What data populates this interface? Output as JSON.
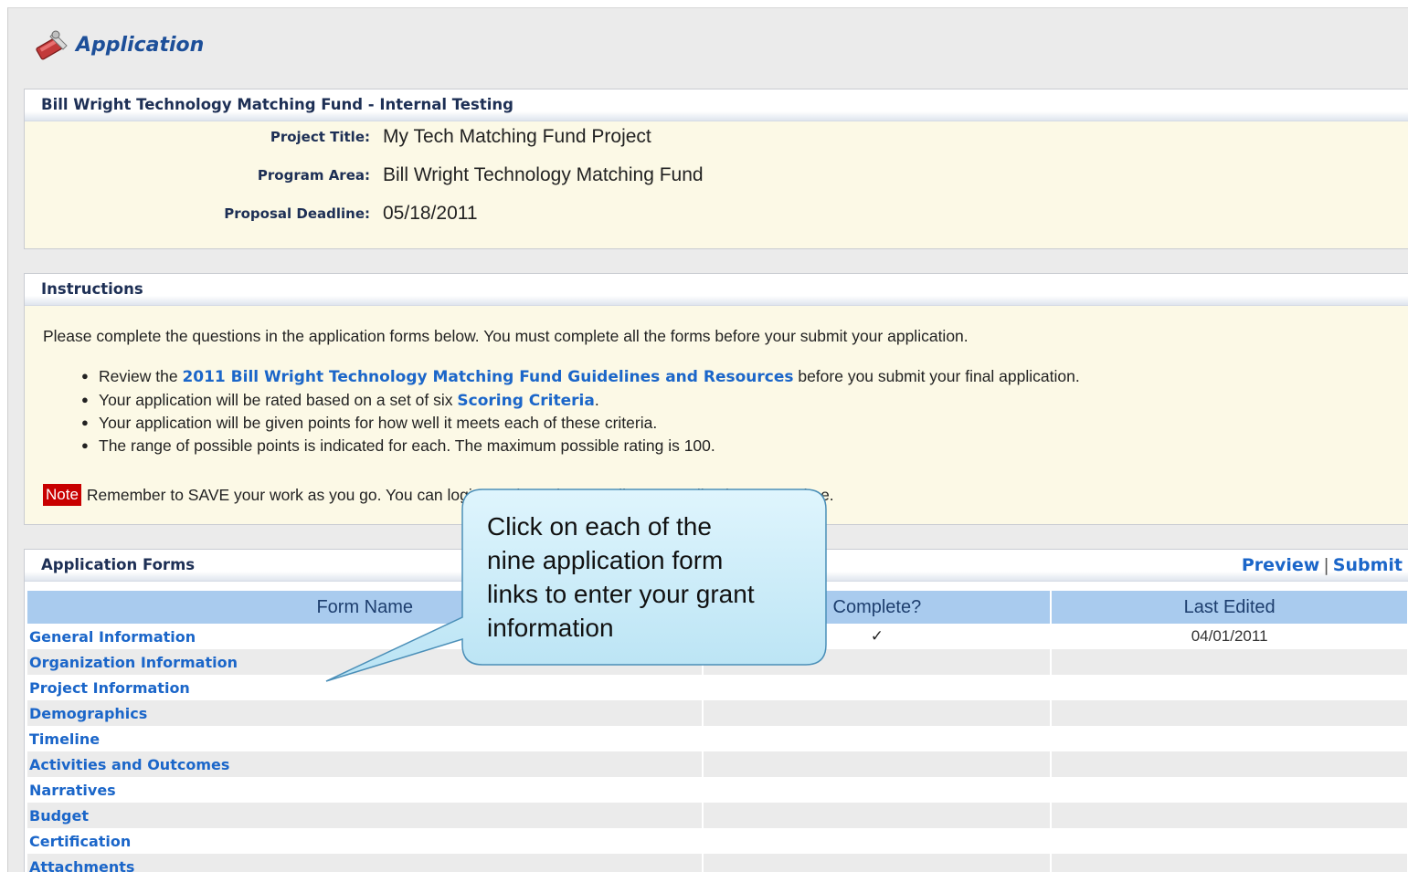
{
  "app": {
    "title": "Application"
  },
  "project": {
    "heading": "Bill Wright Technology Matching Fund - Internal Testing",
    "fields": [
      {
        "label": "Project Title:",
        "value": "My Tech Matching Fund Project"
      },
      {
        "label": "Program Area:",
        "value": "Bill Wright Technology Matching Fund"
      },
      {
        "label": "Proposal Deadline:",
        "value": "05/18/2011"
      }
    ]
  },
  "instructions": {
    "heading": "Instructions",
    "intro": "Please complete the questions in the application forms below. You must complete all the forms before your submit your application.",
    "items": [
      {
        "pre": "Review the ",
        "link": "2011 Bill Wright Technology Matching Fund Guidelines and Resources",
        "post": " before you submit your final application."
      },
      {
        "pre": "Your application will be rated based on a set of six ",
        "link": "Scoring Criteria",
        "post": "."
      },
      {
        "pre": "Your application will be given points for how well it meets each of these criteria.",
        "link": "",
        "post": ""
      },
      {
        "pre": "The range of possible points is indicated for each. The maximum possible rating is 100.",
        "link": "",
        "post": ""
      }
    ],
    "note_badge": "Note",
    "note_text": "Remember to SAVE your work as you go. You can login at a later time to edit your application at any time."
  },
  "forms": {
    "heading": "Application Forms",
    "actions": {
      "preview": "Preview",
      "separator": "|",
      "submit": "Submit"
    },
    "columns": [
      "Form Name",
      "Complete?",
      "Last Edited"
    ],
    "rows": [
      {
        "name": "General Information",
        "complete": "✓",
        "edited": "04/01/2011"
      },
      {
        "name": "Organization Information",
        "complete": "",
        "edited": ""
      },
      {
        "name": "Project Information",
        "complete": "",
        "edited": ""
      },
      {
        "name": "Demographics",
        "complete": "",
        "edited": ""
      },
      {
        "name": "Timeline",
        "complete": "",
        "edited": ""
      },
      {
        "name": "Activities and Outcomes",
        "complete": "",
        "edited": ""
      },
      {
        "name": "Narratives",
        "complete": "",
        "edited": ""
      },
      {
        "name": "Budget",
        "complete": "",
        "edited": ""
      },
      {
        "name": "Certification",
        "complete": "",
        "edited": ""
      },
      {
        "name": "Attachments",
        "complete": "",
        "edited": ""
      }
    ]
  },
  "callout": {
    "lines": [
      "Click on each of the",
      "nine application form",
      "links to enter your grant",
      "information"
    ]
  },
  "colors": {
    "link": "#1b66c9",
    "header_text": "#1d2f55",
    "table_header": "#a9cbee",
    "note": "#c80000",
    "callout_fill": "#cdeefb",
    "callout_stroke": "#4b8fb8"
  }
}
